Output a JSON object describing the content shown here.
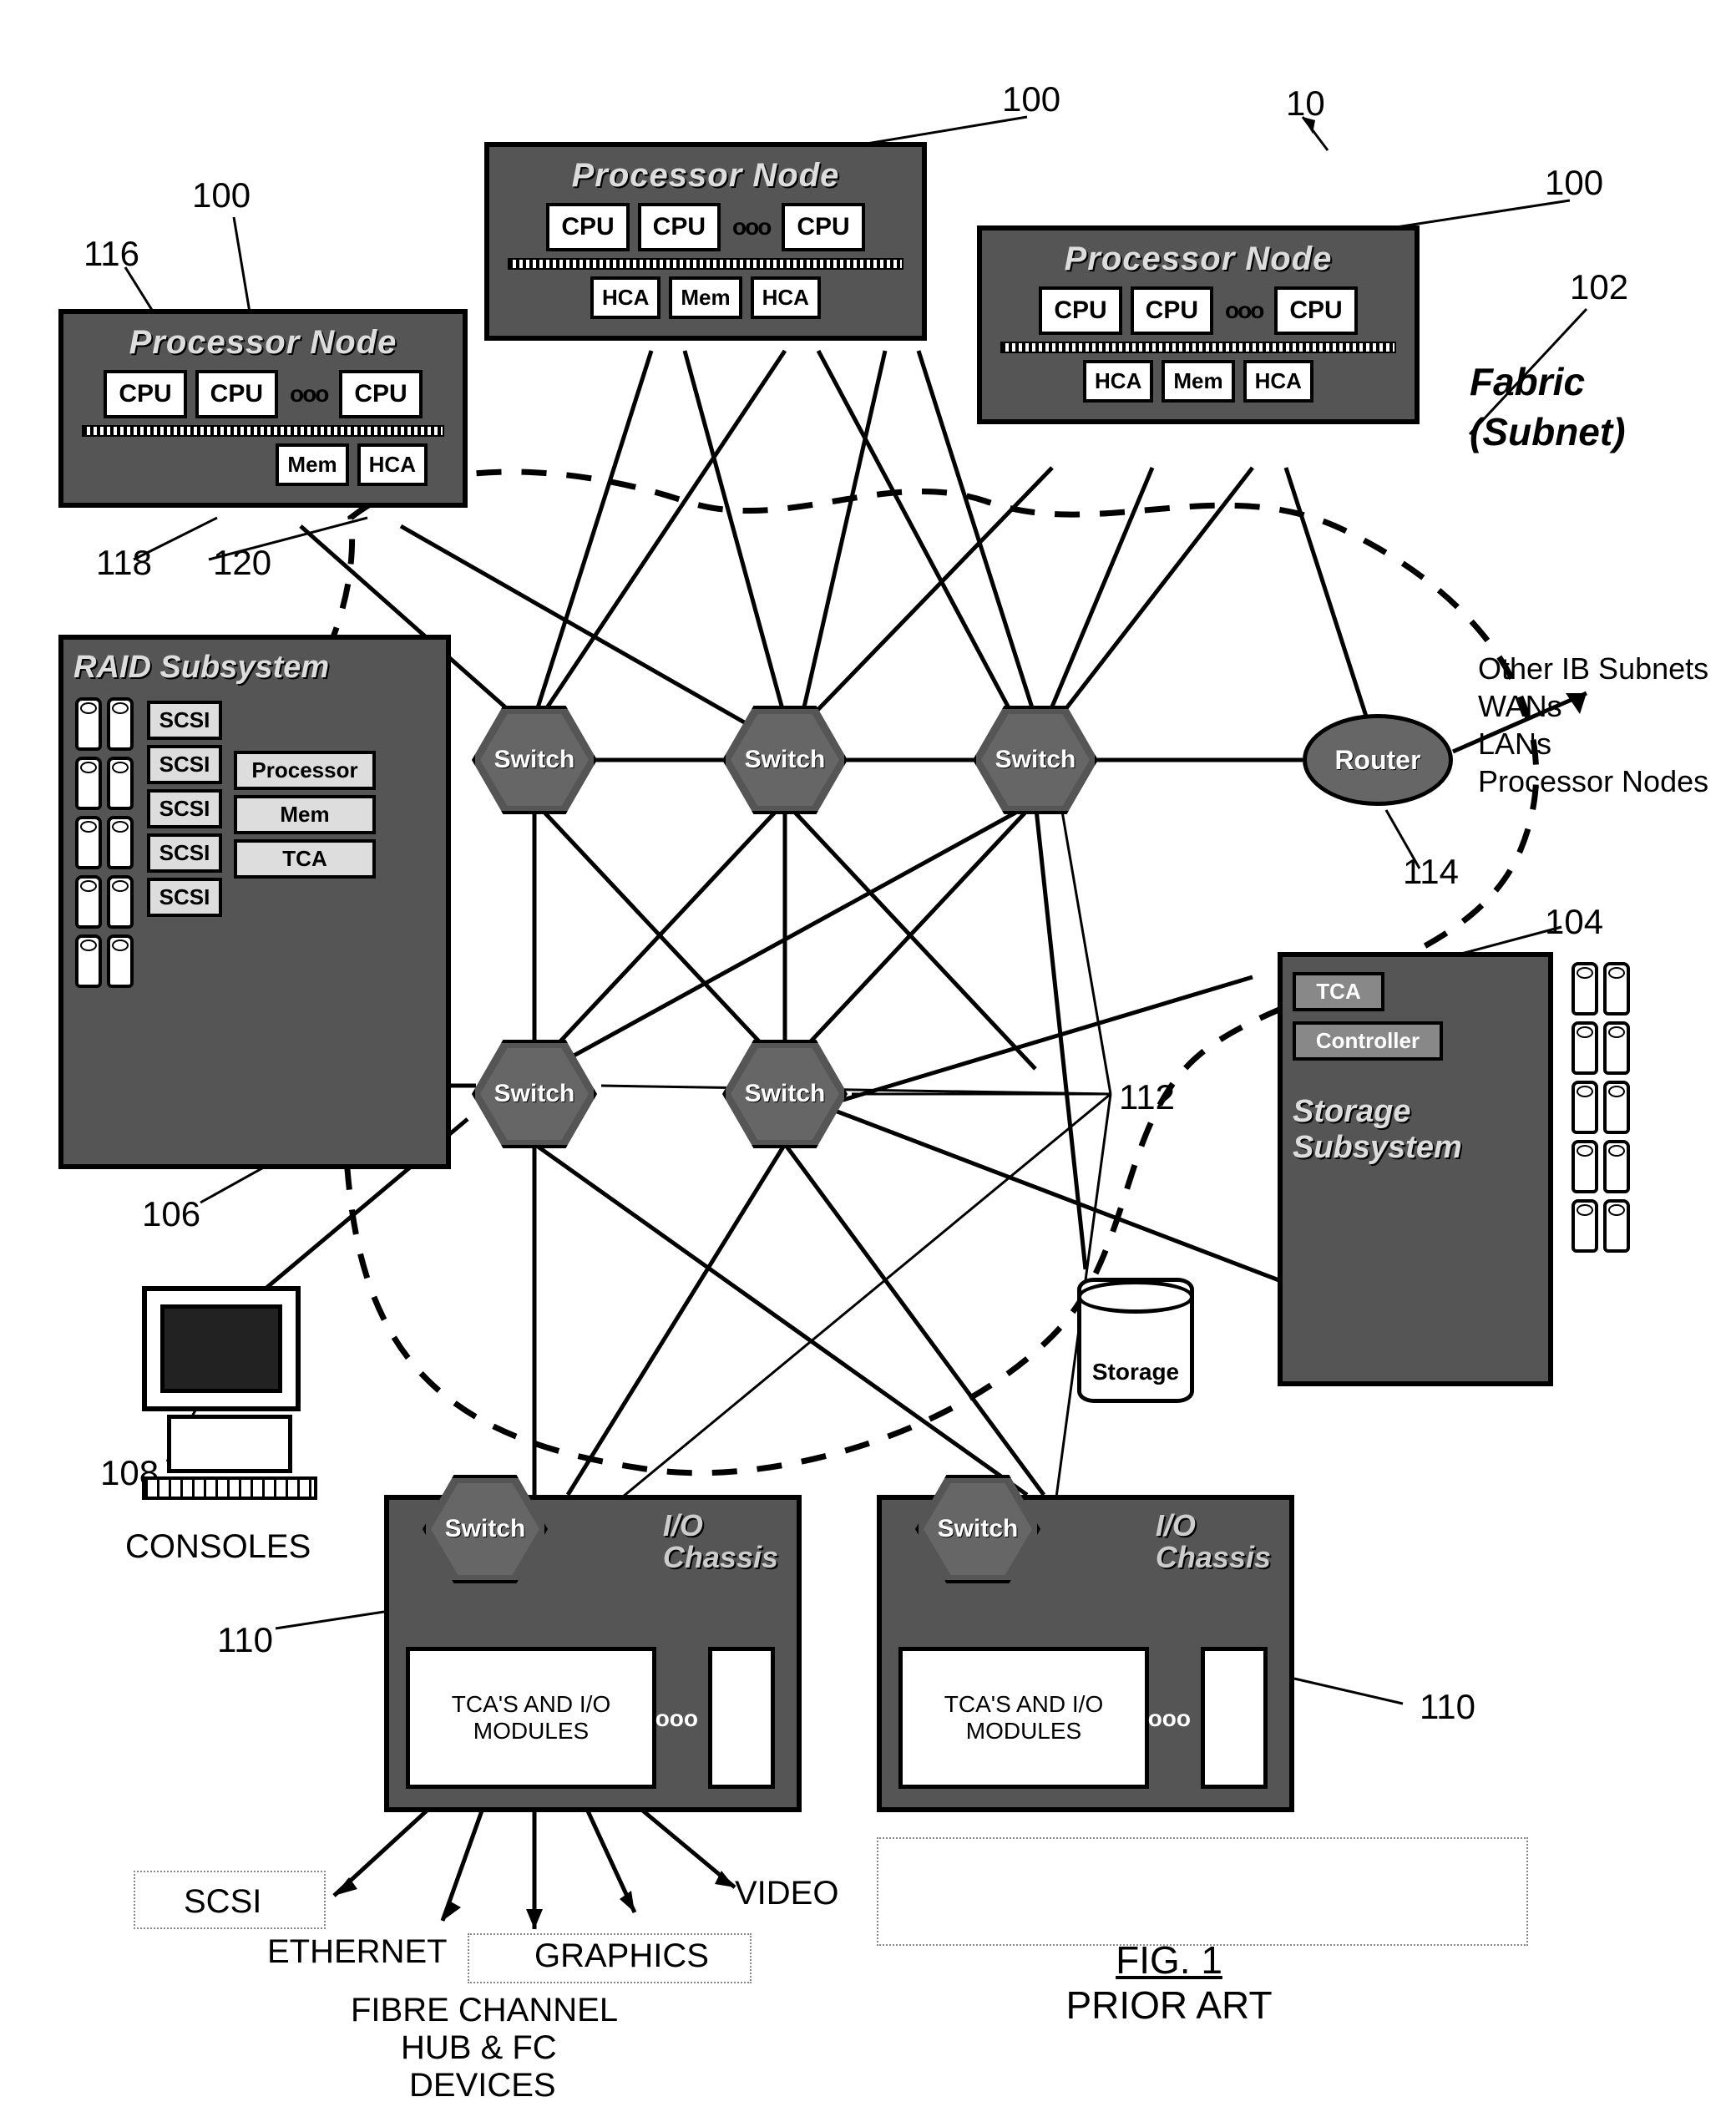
{
  "refs": {
    "r10": "10",
    "r100_top": "100",
    "r100_left": "100",
    "r100_right": "100",
    "r102": "102",
    "r104": "104",
    "r106": "106",
    "r108": "108",
    "r110_left": "110",
    "r110_right": "110",
    "r112": "112",
    "r114": "114",
    "r116": "116",
    "r118": "118",
    "r120": "120"
  },
  "proc": {
    "title": "Processor Node",
    "cpu": "CPU",
    "hca": "HCA",
    "mem": "Mem",
    "dots": "ooo"
  },
  "switch_label": "Switch",
  "router_label": "Router",
  "fabric_label_1": "Fabric",
  "fabric_label_2": "(Subnet)",
  "router_out": {
    "l1": "Other IB Subnets",
    "l2": "WANs",
    "l3": "LANs",
    "l4": "Processor Nodes"
  },
  "raid": {
    "title": "RAID Subsystem",
    "scsi": "SCSI",
    "proc": "Processor",
    "mem": "Mem",
    "tca": "TCA"
  },
  "storage": {
    "title1": "Storage",
    "title2": "Subsystem",
    "tca": "TCA",
    "ctrl": "Controller",
    "cyl": "Storage"
  },
  "io": {
    "title1": "I/O",
    "title2": "Chassis",
    "modules": "TCA'S  AND I/O MODULES",
    "dots": "ooo"
  },
  "console_label": "CONSOLES",
  "io_out": {
    "scsi": "SCSI",
    "eth": "ETHERNET",
    "fc1": "FIBRE CHANNEL",
    "fc2": "HUB & FC",
    "fc3": "DEVICES",
    "gfx": "GRAPHICS",
    "video": "VIDEO"
  },
  "figure": {
    "title": "FIG. 1",
    "sub": "PRIOR ART"
  }
}
